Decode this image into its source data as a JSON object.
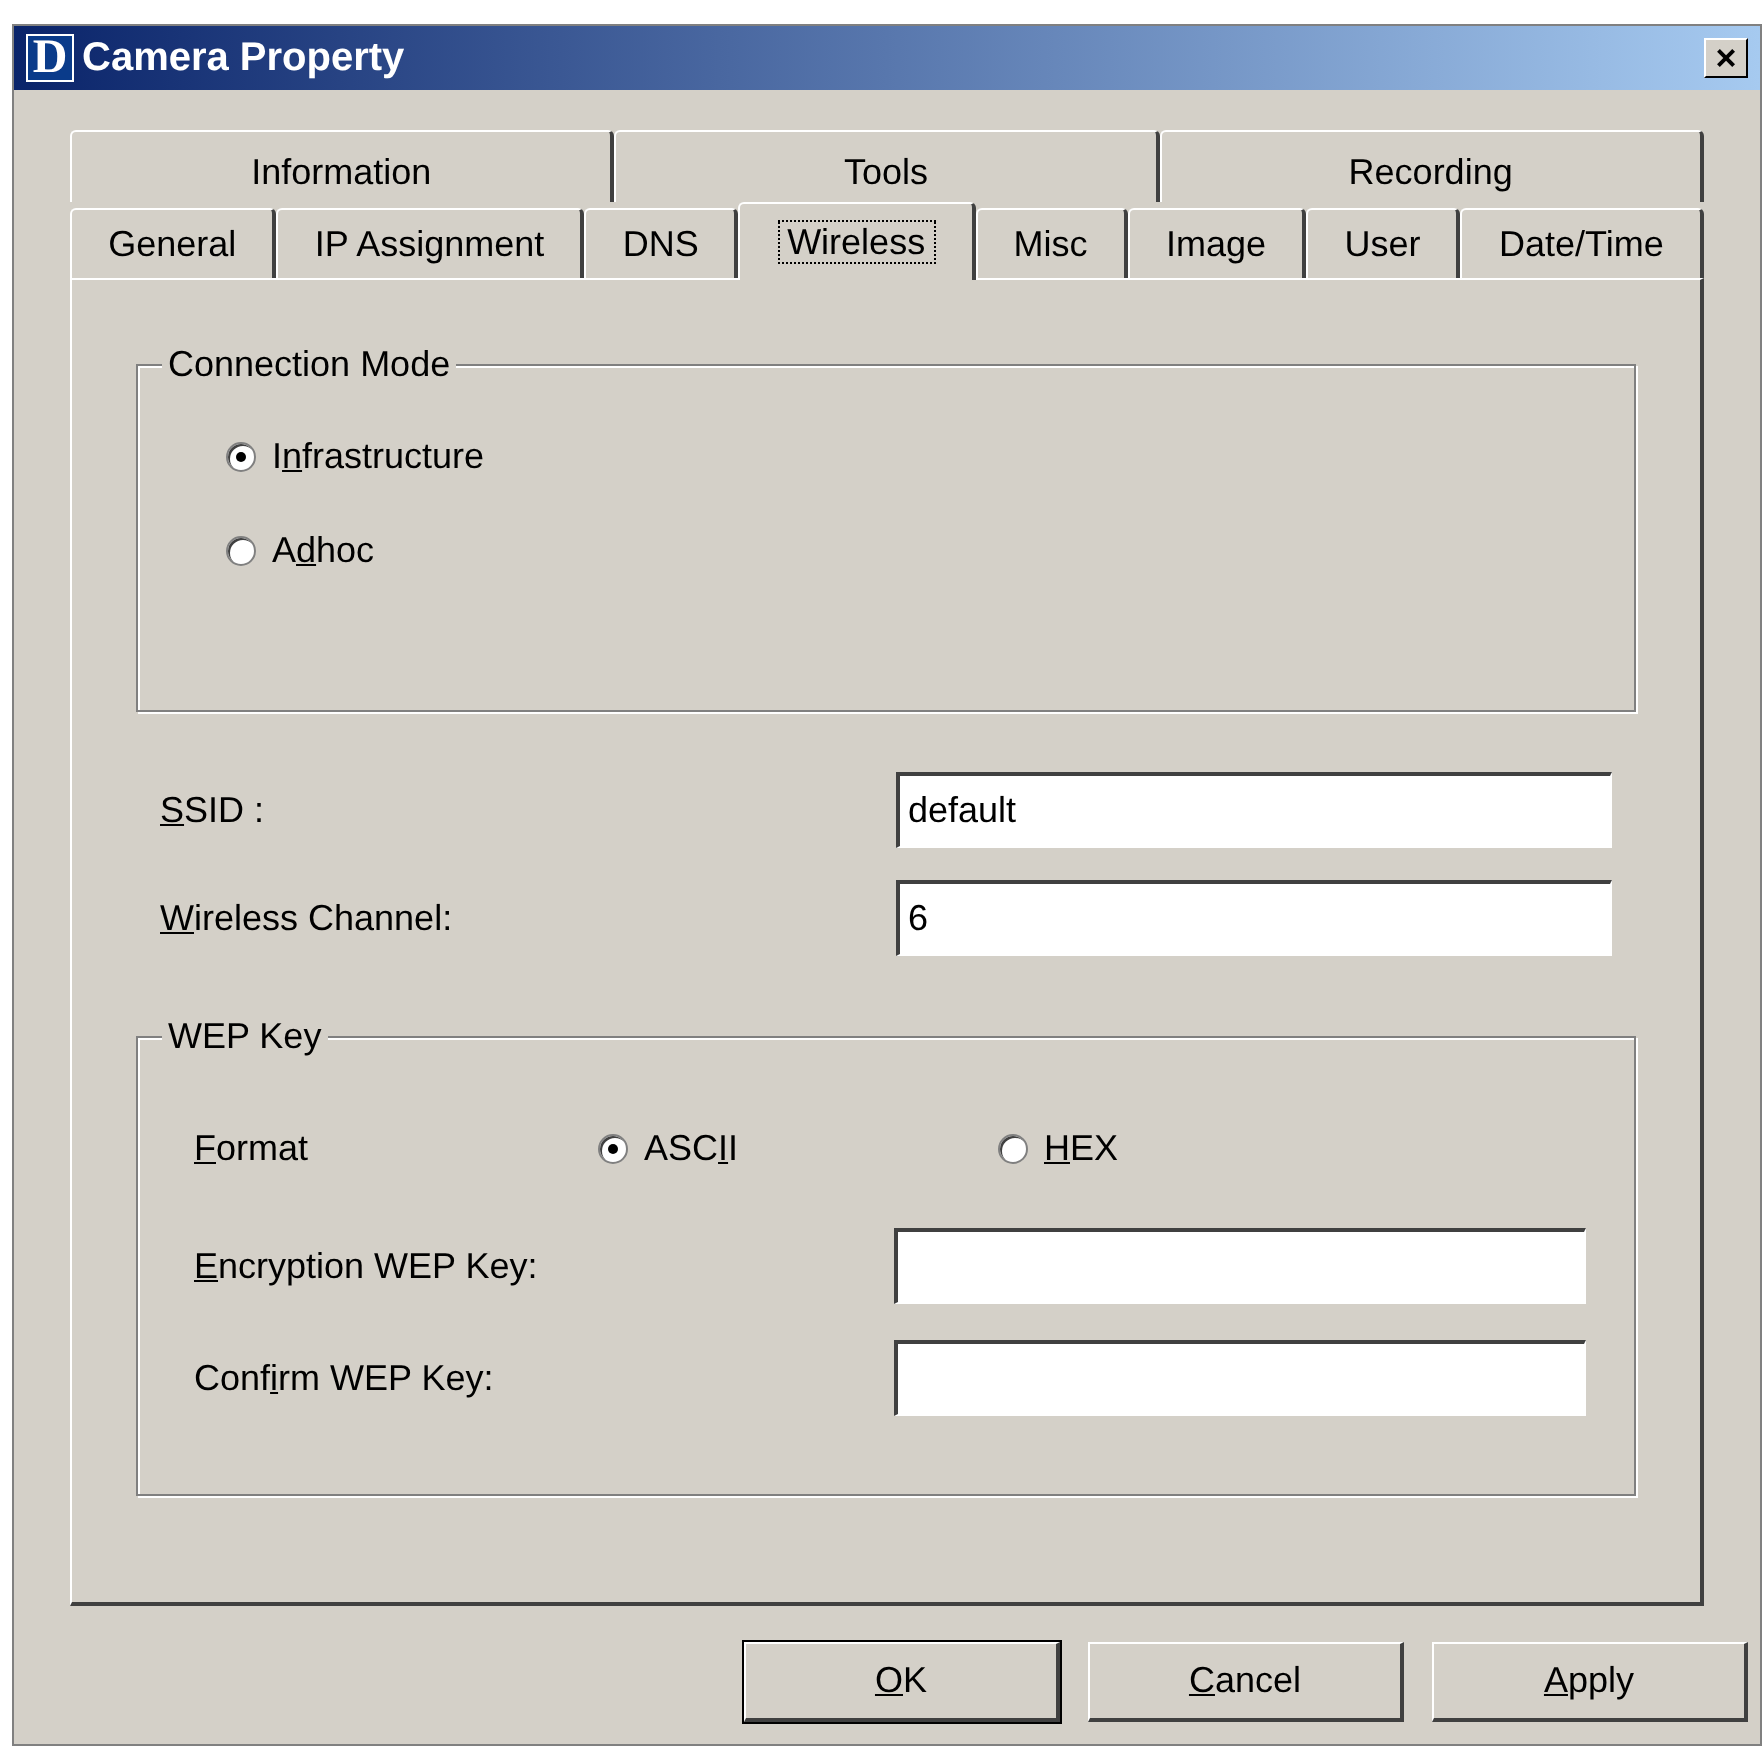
{
  "window": {
    "title": "Camera Property",
    "logo": "D",
    "close": "×"
  },
  "tab_rows": [
    [
      {
        "label": "Information",
        "selected": false
      },
      {
        "label": "Tools",
        "selected": false
      },
      {
        "label": "Recording",
        "selected": false
      }
    ],
    [
      {
        "label": "General",
        "selected": false
      },
      {
        "label": "IP Assignment",
        "selected": false
      },
      {
        "label": "DNS",
        "selected": false
      },
      {
        "label": "Wireless",
        "selected": true
      },
      {
        "label": "Misc",
        "selected": false
      },
      {
        "label": "Image",
        "selected": false
      },
      {
        "label": "User",
        "selected": false
      },
      {
        "label": "Date/Time",
        "selected": false
      }
    ]
  ],
  "connection_mode": {
    "title": "Connection Mode",
    "options": [
      {
        "label": {
          "before": "I",
          "key": "n",
          "after": "frastructure"
        },
        "selected": true
      },
      {
        "label": {
          "before": "A",
          "key": "d",
          "after": "hoc"
        },
        "selected": false
      }
    ]
  },
  "fields": [
    {
      "label": {
        "key": "S",
        "after": "SID :"
      },
      "value": "default"
    },
    {
      "label": {
        "key": "W",
        "after": "ireless Channel:"
      },
      "value": "6"
    }
  ],
  "wep_key": {
    "title": "WEP Key",
    "format_label": {
      "key": "F",
      "after": "ormat"
    },
    "formats": [
      {
        "label": {
          "before": "ASC",
          "key": "I",
          "after": "I"
        },
        "selected": true
      },
      {
        "label": {
          "key": "H",
          "after": "EX"
        },
        "selected": false
      }
    ],
    "fields": [
      {
        "label": {
          "key": "E",
          "after": "ncryption WEP Key:"
        }
      },
      {
        "label": {
          "before": "Conf",
          "key": "i",
          "after": "rm WEP Key:"
        }
      }
    ]
  },
  "buttons": [
    {
      "label": {
        "key": "O",
        "after": "K"
      },
      "default": true
    },
    {
      "label": {
        "key": "C",
        "after": "ancel"
      },
      "default": false
    },
    {
      "label": {
        "key": "A",
        "after": "pply"
      },
      "default": false
    }
  ]
}
